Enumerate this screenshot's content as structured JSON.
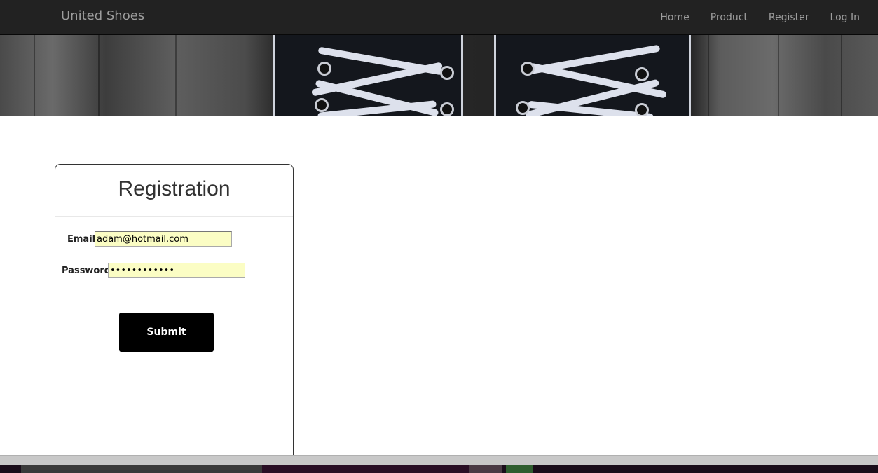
{
  "navbar": {
    "brand": "United Shoes",
    "links": [
      "Home",
      "Product",
      "Register",
      "Log In"
    ]
  },
  "banner": {
    "image": "sneakers-laces-photo"
  },
  "registration": {
    "title": "Registration",
    "email_label": "Email",
    "email_value": "adam@hotmail.com",
    "password_label": "Password",
    "password_value": "••••••••••••",
    "submit_label": "Submit"
  },
  "colors": {
    "navbar_bg": "#222222",
    "nav_text": "#9d9d9d",
    "input_autofill_bg": "#fbfdc4",
    "button_bg": "#000000"
  }
}
